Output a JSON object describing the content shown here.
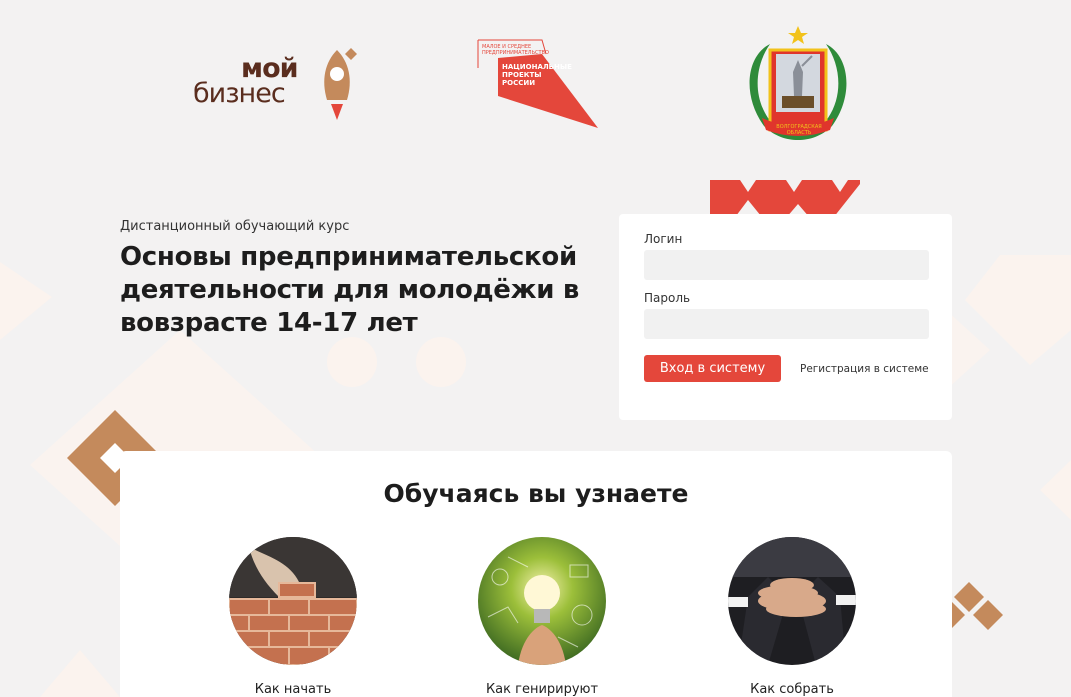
{
  "logos": {
    "moi_biznes": {
      "line1": "мой",
      "line2": "бизнес"
    },
    "national_projects": {
      "small_line1": "МАЛОЕ И СРЕДНЕЕ",
      "small_line2": "ПРЕДПРИНИМАТЕЛЬСТВО",
      "big_line1": "НАЦИОНАЛЬНЫЕ",
      "big_line2": "ПРОЕКТЫ",
      "big_line3": "РОССИИ"
    },
    "emblem": {
      "ribbon_text": "ВОЛГОГРАДСКАЯ ОБЛАСТЬ"
    }
  },
  "course": {
    "subtitle": "Дистанционный обучающий курс",
    "title": "Основы предпринимательской деятельности для молодёжи в вовзрасте 14-17 лет"
  },
  "login": {
    "login_label": "Логин",
    "password_label": "Пароль",
    "login_value": "",
    "password_value": "",
    "submit_label": "Вход в систему",
    "register_label": "Регистрация в системе"
  },
  "learn": {
    "title": "Обучаясь вы узнаете",
    "items": [
      {
        "caption": "Как начать",
        "icon": "bricks-photo"
      },
      {
        "caption": "Как генирируют",
        "icon": "lightbulb-photo"
      },
      {
        "caption": "Как собрать",
        "icon": "team-hands-photo"
      }
    ]
  },
  "colors": {
    "accent_red": "#e4473b",
    "brand_brown": "#5a2d1e",
    "brand_tan": "#c48a5c",
    "background": "#f3f2f2"
  }
}
